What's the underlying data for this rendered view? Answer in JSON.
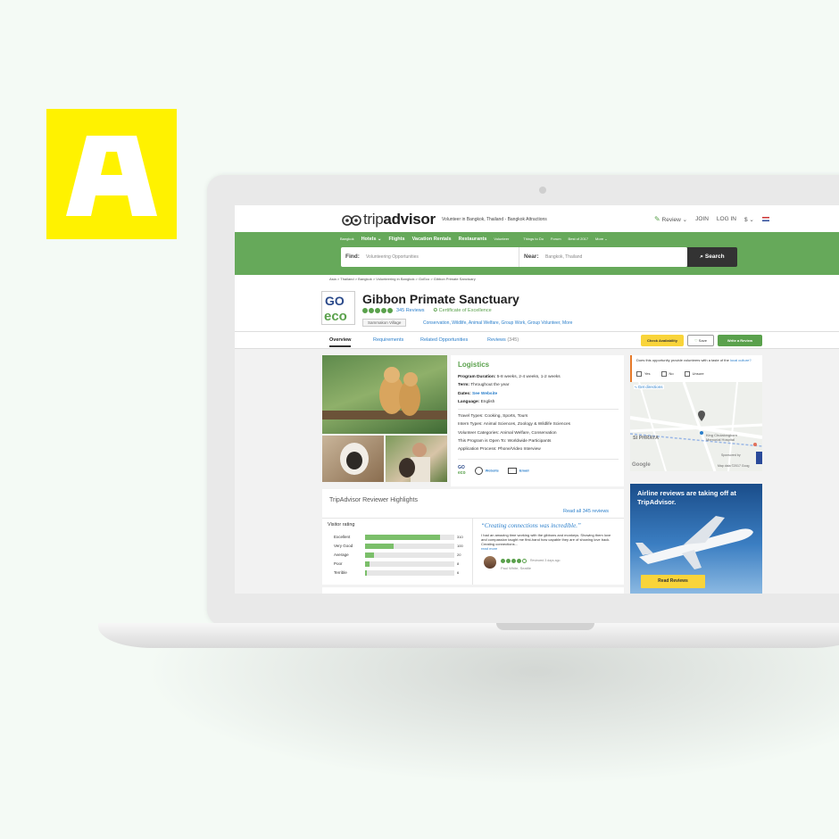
{
  "brand_block": {
    "letter": "A",
    "color": "#fff200"
  },
  "header": {
    "brand_prefix": "trip",
    "brand_suffix": "advisor",
    "page_crumb": "Volunteer in Bangkok, Thailand - Bangkok Attractions",
    "review_label": "Review",
    "join_label": "JOIN",
    "login_label": "LOG IN",
    "currency": "$"
  },
  "nav": {
    "items": [
      "Bangkok",
      "Hotels",
      "Flights",
      "Vacation Rentals",
      "Restaurants",
      "Volunteer"
    ],
    "small_items": [
      "Things to Do",
      "Forum",
      "Best of 2017",
      "More"
    ]
  },
  "search": {
    "find_label": "Find:",
    "find_value": "Volunteering Opportunities",
    "near_label": "Near:",
    "near_value": "Bangkok, Thailand",
    "button_label": "Search"
  },
  "breadcrumb": "Asia > Thailand > Bangkok > Volunteering in Bangkok > GoEco > Gibbon Primate Sanctuary",
  "listing": {
    "title": "Gibbon Primate Sanctuary",
    "reviews_link": "345 Reviews",
    "certificate": "Certificate of Excellence",
    "tag": "Sammakon Village",
    "categories": "Conservation, Wildlife, Animal Welfare, Group Work, Group Volunteer, More",
    "rating_bubbles": 5
  },
  "tabs": {
    "overview": "Overview",
    "requirements": "Requirements",
    "related": "Related Opportunities",
    "reviews": "Reviews",
    "reviews_count": "(345)",
    "check_availability": "Check Availability",
    "save": "Save",
    "write_review": "Write a Review"
  },
  "logistics": {
    "title": "Logistics",
    "program_duration_label": "Program Duration:",
    "program_duration": "5-8 weeks, 2-4 weeks, 1-2 weeks",
    "term_label": "Term:",
    "term": "Throughout the year",
    "dates_label": "Dates:",
    "dates": "See Website",
    "language_label": "Language:",
    "language": "English",
    "travel_types_label": "Travel Types:",
    "travel_types": "Cooking, Sports, Tours",
    "intern_types_label": "Intern Types:",
    "intern_types": "Animal Sciences, Zoology & Wildlife Sciences",
    "volunteer_label": "Volunteer Categories:",
    "volunteer": "Animal Welfare, Conservation",
    "open_to_label": "This Program is Open To:",
    "open_to": "Worldwide Participants",
    "application_label": "Application Process:",
    "application": "Phone/Video Interview",
    "website_label": "Website",
    "email_label": "Email",
    "go_logo_top": "GO",
    "go_logo_bottom": "eco"
  },
  "ask": {
    "question": "Does this opportunity provide volunteers with a taste of the",
    "question_link": "local culture?",
    "yes": "Yes",
    "no": "No",
    "unsure": "Unsure"
  },
  "map": {
    "directions": "Get directions",
    "district": "SI PHRAYA",
    "hospital": "King Chulalongkorn Memorial Hospital",
    "sponsored": "Sponsored by",
    "google": "Google",
    "map_data": "Map data ©2017 Goog"
  },
  "ad": {
    "text": "Airline reviews are taking off at TripAdvisor.",
    "button": "Read Reviews"
  },
  "highlights": {
    "title": "TripAdvisor Reviewer Highlights",
    "read_all": "Read all 345 reviews",
    "visitor_rating": "Visitor rating",
    "rows": [
      {
        "label": "Excellent",
        "count": "310",
        "fraction": 0.84
      },
      {
        "label": "Very Good",
        "count": "100",
        "fraction": 0.32
      },
      {
        "label": "Average",
        "count": "20",
        "fraction": 0.1
      },
      {
        "label": "Poor",
        "count": "8",
        "fraction": 0.05
      },
      {
        "label": "Terrible",
        "count": "6",
        "fraction": 0.02
      }
    ],
    "quote": "“Creating connections was incredible.”",
    "quote_body": "I had an amazing time working with the gibbons and monkeys. Showing them love and compassion taught me first-hand how capable they are of showing love back. Creating connections...",
    "read_more": "read more",
    "review_date": "Reviewed 3 days ago",
    "reviewer": "Paul White, Seattle",
    "review_bubbles": 4
  },
  "colors": {
    "green": "#66a95a",
    "link": "#2b7fcb",
    "yellow": "#f9d43a"
  }
}
